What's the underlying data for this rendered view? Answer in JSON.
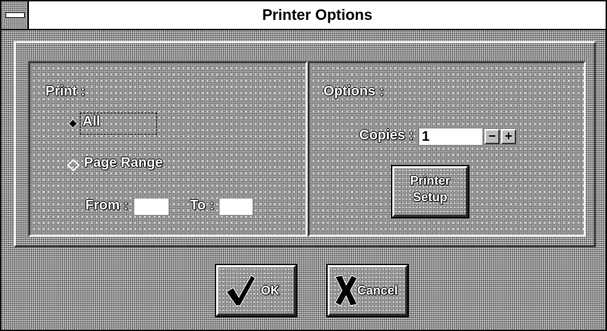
{
  "window": {
    "title": "Printer Options"
  },
  "print_group": {
    "heading": "Print :",
    "option_all": "All",
    "option_page_range": "Page Range",
    "selected": "All",
    "from_label": "From :",
    "from_value": "",
    "to_label": "To :",
    "to_value": ""
  },
  "options_group": {
    "heading": "Options :",
    "copies_label": "Copies :",
    "copies_value": "1",
    "decrement_glyph": "−",
    "increment_glyph": "+",
    "printer_setup_line1": "Printer",
    "printer_setup_line2": "Setup"
  },
  "buttons": {
    "ok_label": "OK",
    "ok_icon": "checkmark-icon",
    "cancel_label": "Cancel",
    "cancel_icon": "x-cross-icon"
  }
}
